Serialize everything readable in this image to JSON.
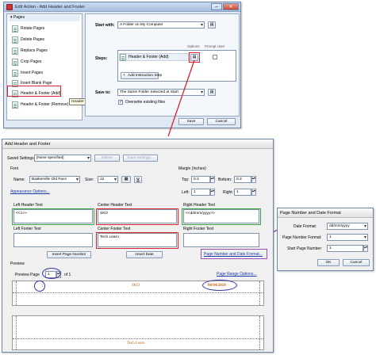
{
  "edit_action": {
    "title": "Edit Action - Add Header and Footer",
    "pages_header": "Pages",
    "list_items": [
      {
        "label": "Rotate Pages"
      },
      {
        "label": "Delete Pages"
      },
      {
        "label": "Replace Pages"
      },
      {
        "label": "Crop Pages"
      },
      {
        "label": "Insert Pages"
      },
      {
        "label": "Insert Blank Page"
      },
      {
        "label": "Header & Footer (Add)"
      },
      {
        "label": "Header & Footer (Remove)"
      }
    ],
    "tooltip": "Header & Footer (Add)",
    "start_with_label": "Start with:",
    "start_with_value": "A Folder on My Computer",
    "options_header": "Options",
    "prompt_user_header": "Prompt User",
    "steps_label": "Steps:",
    "step_item": "Header & Footer (Add)",
    "add_instruction_step": "Add Instruction Step",
    "save_to_label": "Save to:",
    "save_to_value": "The Same Folder Selected at Start",
    "overwrite_label": "Overwrite existing files",
    "save_button": "Save",
    "cancel_button": "Cancel"
  },
  "add_hf": {
    "title": "Add Header and Footer",
    "saved_settings_label": "Saved Settings:",
    "saved_settings_value": "[None specified]",
    "delete_button": "Delete",
    "save_settings_button": "Save Settings...",
    "font_label": "Font",
    "name_label": "Name:",
    "font_name": "Baskerville Old Face",
    "size_label": "Size:",
    "font_size": "12",
    "underline_btn": "U",
    "appearance_link": "Appearance Options...",
    "margin_label": "Margin (Inches)",
    "top_label": "Top:",
    "top_value": "0.3",
    "bottom_label": "Bottom:",
    "bottom_value": "0.3",
    "left_label": "Left:",
    "left_value": "1",
    "right_label": "Right:",
    "right_value": "1",
    "left_header_label": "Left Header Text",
    "left_header_value": "<<1>>",
    "center_header_label": "Center Header Text",
    "center_header_value": "SKO",
    "right_header_label": "Right Header Text",
    "right_header_value": "<<dd/mm/yyyy>>",
    "left_footer_label": "Left Footer Text",
    "center_footer_label": "Center Footer Text",
    "center_footer_value": "Tech Learn",
    "right_footer_label": "Right Footer Text",
    "insert_page_number": "Insert Page Number",
    "insert_date": "Insert Date",
    "page_number_date_link": "Page Number and Date Format...",
    "preview_label": "Preview",
    "preview_page_label": "Preview Page",
    "preview_page_value": "1",
    "of_label": "of 1",
    "page_range_link": "Page Range Options...",
    "preview_left_header": "1",
    "preview_center_header": "SKO",
    "preview_right_header": "08/04/2018",
    "preview_footer": "Tech Learn"
  },
  "pnd": {
    "title": "Page Number and Date Format",
    "date_format_label": "Date Format:",
    "date_format_value": "dd/mm/yyyy",
    "page_number_format_label": "Page Number Format:",
    "page_number_format_value": "1",
    "start_page_label": "Start Page Number:",
    "start_page_value": "1",
    "ok_button": "OK",
    "cancel_button": "Cancel"
  },
  "colors": {
    "highlight_red": "#d9232e",
    "highlight_green": "#37a748",
    "highlight_purple": "#9b4bb2",
    "highlight_blue": "#3433a1",
    "preview_text": "#c2641d"
  }
}
